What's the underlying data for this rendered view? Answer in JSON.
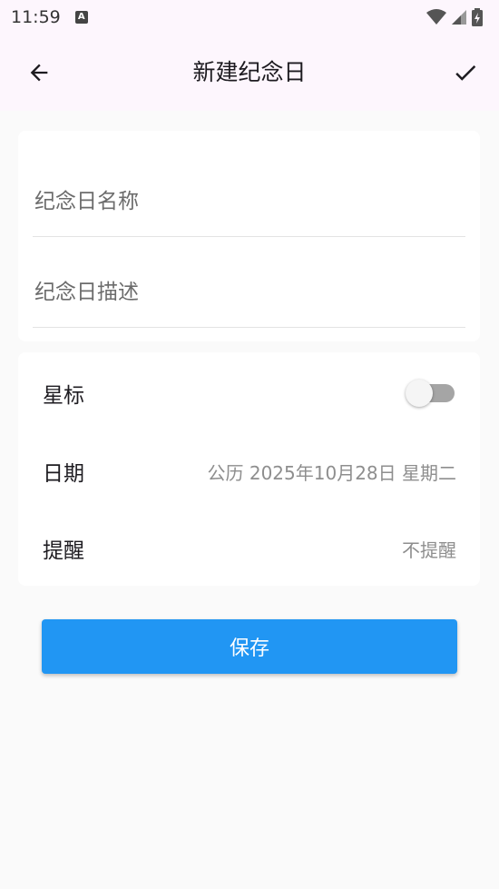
{
  "status_bar": {
    "time": "11:59",
    "notification_icon": "A"
  },
  "app_bar": {
    "title": "新建纪念日",
    "back_icon": "arrow-left-icon",
    "confirm_icon": "check-icon"
  },
  "form": {
    "name_placeholder": "纪念日名称",
    "name_value": "",
    "description_placeholder": "纪念日描述",
    "description_value": ""
  },
  "settings": {
    "star_label": "星标",
    "star_enabled": false,
    "date_label": "日期",
    "date_value": "公历 2025年10月28日 星期二",
    "reminder_label": "提醒",
    "reminder_value": "不提醒"
  },
  "save_button": {
    "label": "保存"
  },
  "colors": {
    "primary": "#2196f3",
    "app_bar_bg": "#fdf6fd",
    "page_bg": "#fafafa"
  }
}
